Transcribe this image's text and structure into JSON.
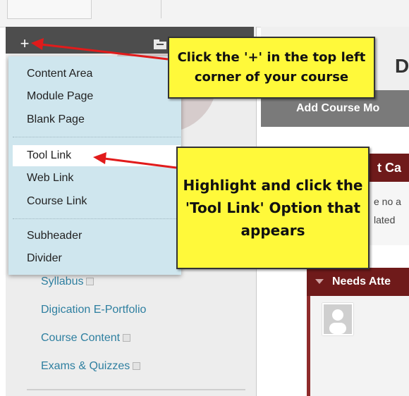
{
  "course_toolbar": {
    "plus_glyph": "+"
  },
  "dropdown": {
    "items": [
      {
        "label": "Content Area"
      },
      {
        "label": "Module Page"
      },
      {
        "label": "Blank Page"
      },
      {
        "label": "Tool Link",
        "highlighted": true
      },
      {
        "label": "Web Link"
      },
      {
        "label": "Course Link"
      },
      {
        "label": "Subheader"
      },
      {
        "label": "Divider"
      }
    ]
  },
  "nav": {
    "items": [
      {
        "label": "Syllabus"
      },
      {
        "label": "Digication E-Portfolio"
      },
      {
        "label": "Course Content"
      },
      {
        "label": "Exams & Quizzes"
      }
    ]
  },
  "right": {
    "header_letter": "D",
    "gray_bar_text": "Add Course Mo",
    "maroon_header": "t Ca",
    "maroon_lines": [
      "e no a",
      "lated"
    ],
    "needs_header": "Needs Atte"
  },
  "callouts": {
    "one": [
      "Click the '+' in the top left",
      "corner of your course"
    ],
    "two": [
      "Highlight and click the",
      "'Tool Link' Option that",
      "appears"
    ]
  },
  "colors": {
    "accent_red": "#e11b1b",
    "callout_yellow": "#fff93a",
    "maroon": "#6f1a1a",
    "dropdown_bg": "#cfe6ee",
    "link_blue": "#2e7fa0"
  }
}
